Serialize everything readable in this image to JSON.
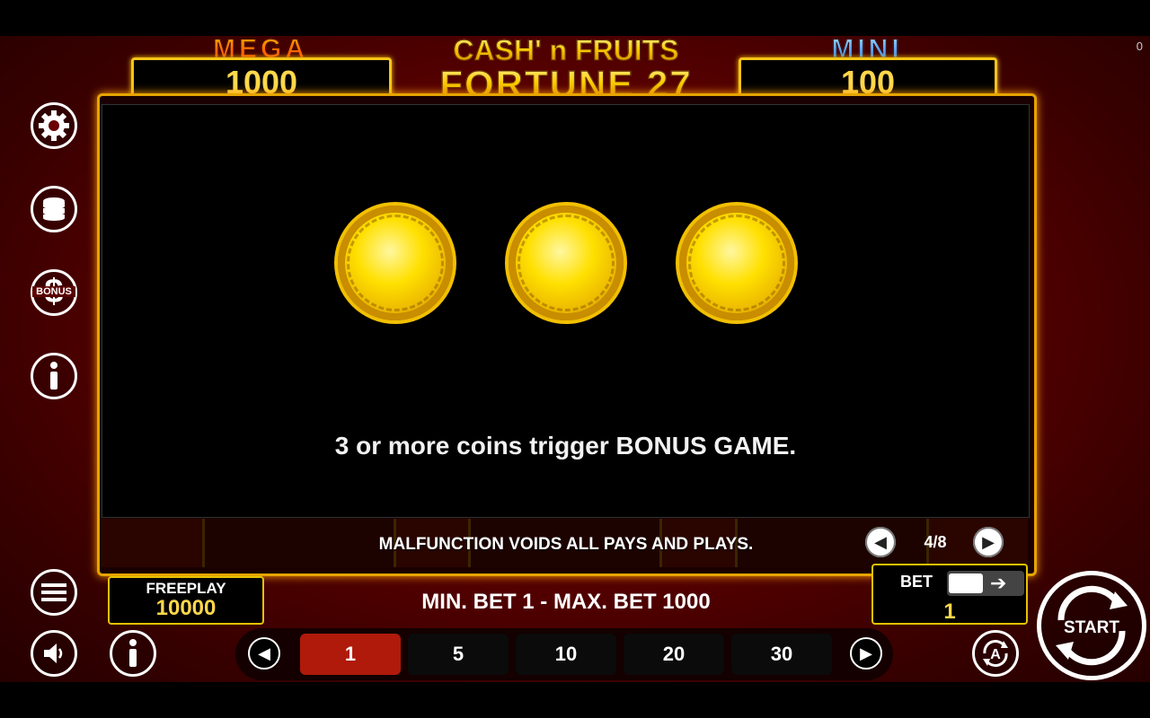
{
  "corner_counter": "0",
  "jackpots": {
    "mega": {
      "label": "MEGA",
      "value": "1000"
    },
    "mini": {
      "label": "MINI",
      "value": "100"
    }
  },
  "logo": {
    "line1": "CASH' n FRUITS",
    "line2": "FORTUNE 27"
  },
  "paytable": {
    "message": "3 or more coins trigger BONUS GAME.",
    "page": "4/8"
  },
  "footer_notice": "MALFUNCTION VOIDS ALL PAYS AND PLAYS.",
  "side_icons": [
    "gear-icon",
    "coins-stack-icon",
    "bonus-dollar-icon",
    "info-icon"
  ],
  "bonus_icon_text": "BONUS",
  "freeplay": {
    "label": "FREEPLAY",
    "value": "10000"
  },
  "bet_limits": "MIN. BET 1 - MAX. BET 1000",
  "bet": {
    "label": "BET",
    "value": "1"
  },
  "bet_options": [
    "1",
    "5",
    "10",
    "20",
    "30"
  ],
  "selected_bet": "1",
  "start_label": "START",
  "colors": {
    "gold": "#f5c518",
    "accent_red": "#b01a0a",
    "jackpot_value": "#ffd84a"
  }
}
